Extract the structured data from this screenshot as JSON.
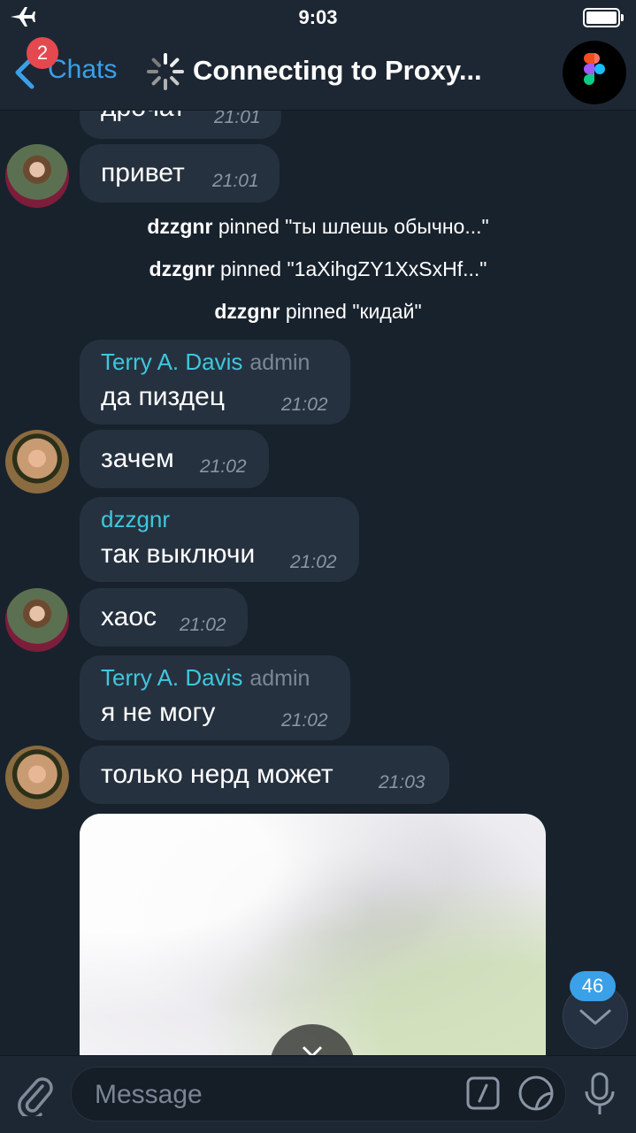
{
  "status": {
    "time": "9:03"
  },
  "header": {
    "back_label": "Chats",
    "unread_badge": "2",
    "title": "Connecting to Proxy..."
  },
  "messages": {
    "m0": {
      "text": "дрочат",
      "time": "21:01"
    },
    "m1": {
      "text": "привет",
      "time": "21:01"
    },
    "service": [
      {
        "user": "dzzgnr",
        "text": "pinned \"ты шлешь обычно...\""
      },
      {
        "user": "dzzgnr",
        "text": "pinned \"1aXihgZY1XxSxHf...\""
      },
      {
        "user": "dzzgnr",
        "text": "pinned \"кидай\""
      }
    ],
    "m2": {
      "author": "Terry A. Davis",
      "role": "admin",
      "text": "да пиздец",
      "time": "21:02"
    },
    "m3": {
      "text": "зачем",
      "time": "21:02"
    },
    "m4": {
      "author": "dzzgnr",
      "text": "так выключи",
      "time": "21:02"
    },
    "m5": {
      "text": "хаос",
      "time": "21:02"
    },
    "m6": {
      "author": "Terry A. Davis",
      "role": "admin",
      "text": "я не могу",
      "time": "21:02"
    },
    "m7": {
      "text": "только нерд может",
      "time": "21:03"
    }
  },
  "scroll_down": {
    "badge": "46"
  },
  "input": {
    "placeholder": "Message"
  },
  "colors": {
    "accent": "#3aa0e8",
    "author": "#3ec7de",
    "bubble": "#26313f",
    "background": "#18222d",
    "badge_red": "#e6484f"
  },
  "icons": [
    "airplane-icon",
    "battery-icon",
    "back-chevron-icon",
    "loading-spinner-icon",
    "figma-logo-icon",
    "download-icon",
    "chevron-down-icon",
    "paperclip-icon",
    "slash-command-icon",
    "sticker-icon",
    "microphone-icon"
  ]
}
